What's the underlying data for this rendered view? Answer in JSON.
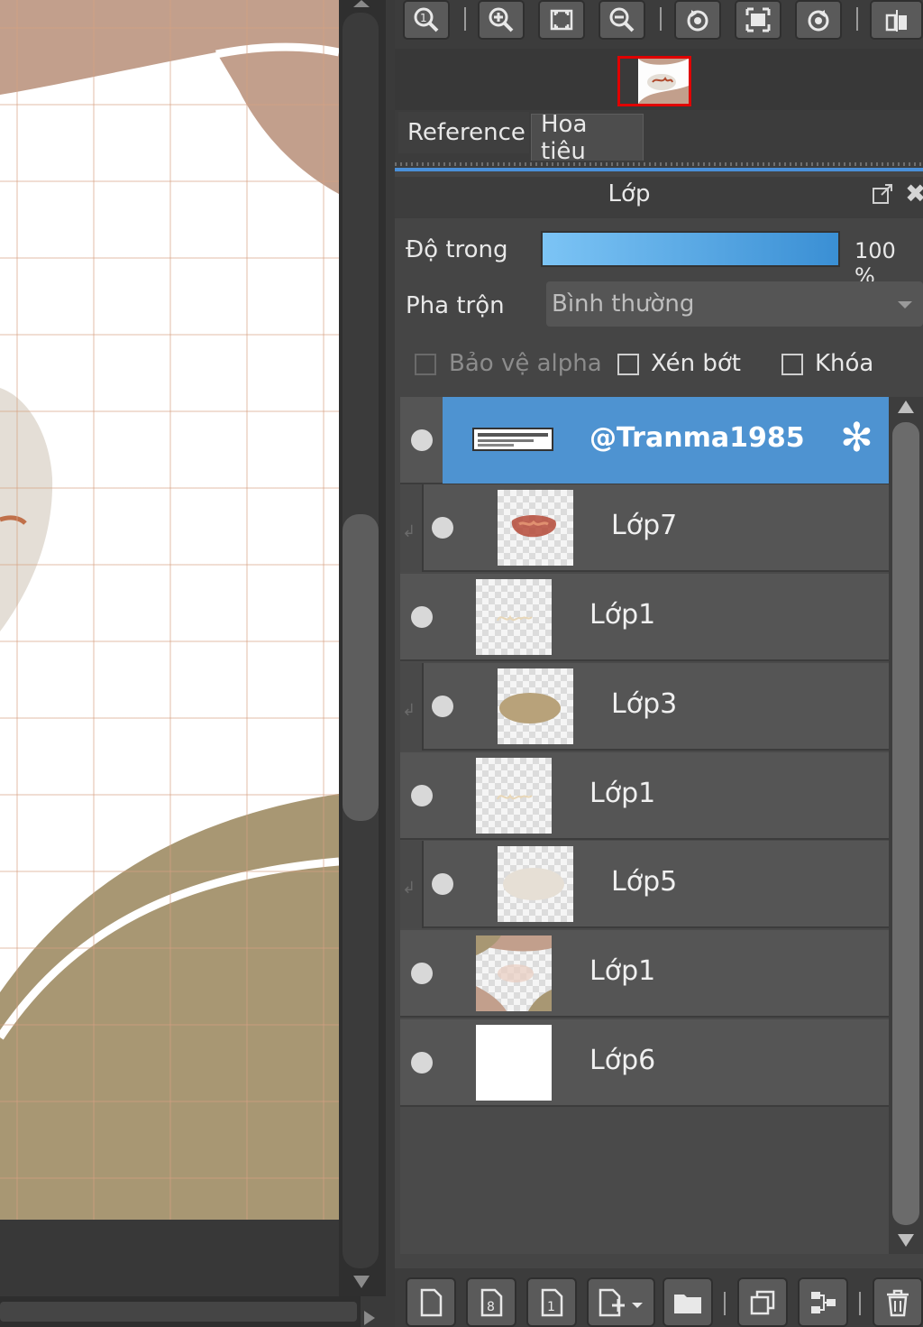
{
  "toolbar": {
    "icons": [
      "zoom-actual-icon",
      "zoom-in-icon",
      "fit-screen-icon",
      "zoom-out-icon",
      "rotate-left-icon",
      "fit-window-icon",
      "rotate-right-icon",
      "flip-icon"
    ]
  },
  "tabs": {
    "reference": "Reference",
    "navigator": "Hoa tiêu"
  },
  "layer_panel": {
    "title": "Lớp",
    "opacity_label": "Độ trong",
    "opacity_value": "100 %",
    "opacity_fraction": 1.0,
    "blend_label": "Pha trộn",
    "blend_value": "Bình thường",
    "protect_alpha_label": "Bảo vệ alpha",
    "clipping_label": "Xén bớt",
    "lock_label": "Khóa"
  },
  "layers": [
    {
      "name": "@Tranma1985",
      "selected": true,
      "clipped": false,
      "thumb": "text-banner"
    },
    {
      "name": "Lớp7",
      "selected": false,
      "clipped": true,
      "thumb": "red-smudge"
    },
    {
      "name": "Lớp1",
      "selected": false,
      "clipped": false,
      "thumb": "faint-script"
    },
    {
      "name": "Lớp3",
      "selected": false,
      "clipped": true,
      "thumb": "tan-blob"
    },
    {
      "name": "Lớp1",
      "selected": false,
      "clipped": false,
      "thumb": "faint-script"
    },
    {
      "name": "Lớp5",
      "selected": false,
      "clipped": true,
      "thumb": "beige-blob"
    },
    {
      "name": "Lớp1",
      "selected": false,
      "clipped": false,
      "thumb": "shapes"
    },
    {
      "name": "Lớp6",
      "selected": false,
      "clipped": false,
      "thumb": "white"
    }
  ],
  "colors": {
    "selection": "#4e93d1",
    "accent_tab_line": "#4a90d9",
    "canvas_pink": "#c29f8c",
    "canvas_tan": "#a89773",
    "navigator_frame": "#e00000"
  }
}
